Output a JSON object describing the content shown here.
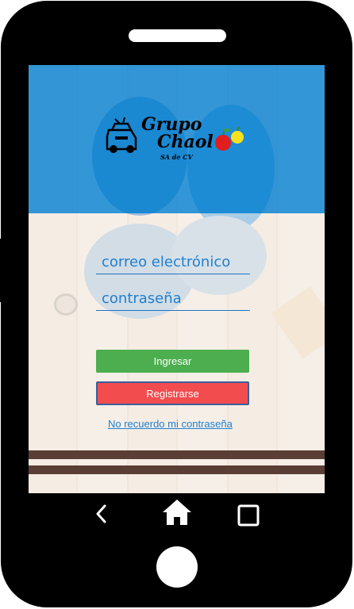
{
  "app": {
    "logo": {
      "line1": "Grupo",
      "line2": "Chaol",
      "line3": "SA de CV"
    }
  },
  "login": {
    "email_placeholder": "correo electrónico",
    "password_placeholder": "contraseña",
    "login_label": "Ingresar",
    "register_label": "Registrarse",
    "forgot_label": "No recuerdo mi contraseña"
  },
  "nav": {
    "back_icon": "chevron-left-icon",
    "home_icon": "home-icon",
    "recents_icon": "square-icon"
  },
  "colors": {
    "header_blue": "#198cd7",
    "login_green": "#4cae4f",
    "register_red": "#f24c4f",
    "link_blue": "#1f7fd0",
    "stripe_brown": "#5a3e35"
  }
}
